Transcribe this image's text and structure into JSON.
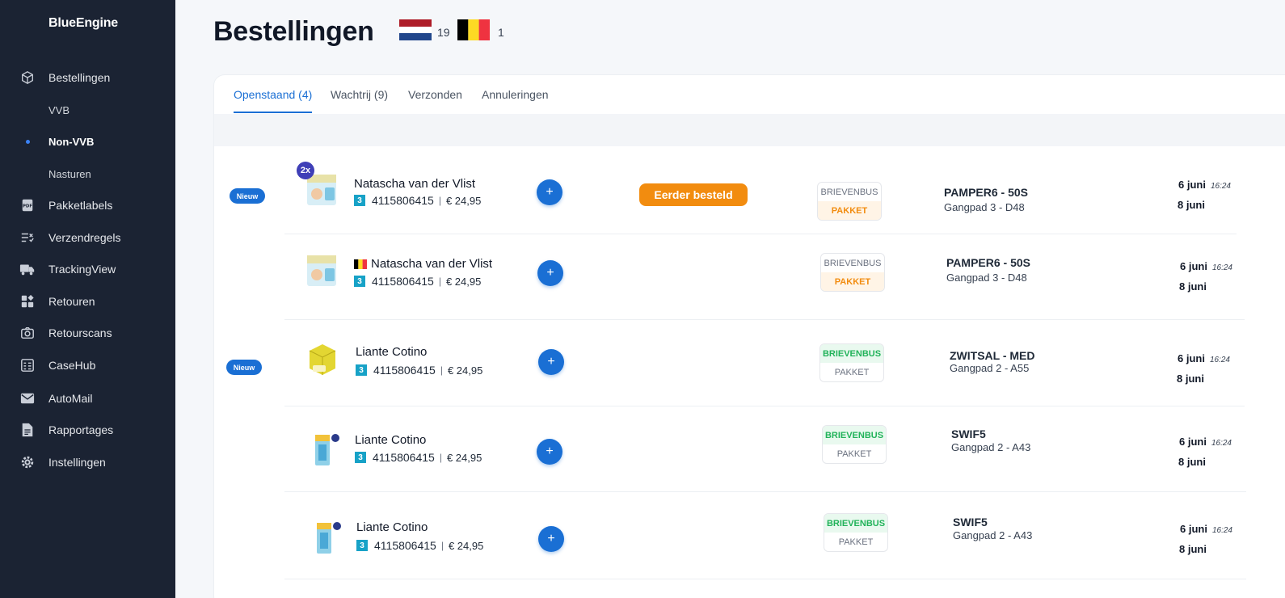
{
  "app": {
    "name": "BlueEngine"
  },
  "sidebar": {
    "items": [
      {
        "label": "Bestellingen",
        "icon": "box-icon"
      },
      {
        "label": "VVB",
        "sub": true
      },
      {
        "label": "Non-VVB",
        "sub": true,
        "active": true
      },
      {
        "label": "Nasturen",
        "sub": true
      },
      {
        "label": "Pakketlabels",
        "icon": "pdf-icon"
      },
      {
        "label": "Verzendregels",
        "icon": "rules-icon"
      },
      {
        "label": "TrackingView",
        "icon": "truck-icon"
      },
      {
        "label": "Retouren",
        "icon": "retour-icon"
      },
      {
        "label": "Retourscans",
        "icon": "camera-icon"
      },
      {
        "label": "CaseHub",
        "icon": "casehub-icon"
      },
      {
        "label": "AutoMail",
        "icon": "mail-icon"
      },
      {
        "label": "Rapportages",
        "icon": "report-icon"
      },
      {
        "label": "Instellingen",
        "icon": "gear-icon"
      }
    ]
  },
  "header": {
    "title": "Bestellingen",
    "countries": [
      {
        "flag": "netherlands-flag",
        "count": "19"
      },
      {
        "flag": "belgium-flag",
        "count": "1"
      }
    ]
  },
  "tabs": [
    {
      "label": "Openstaand (4)",
      "active": true
    },
    {
      "label": "Wachtrij (9)"
    },
    {
      "label": "Verzonden"
    },
    {
      "label": "Annuleringen"
    }
  ],
  "orders": [
    {
      "is_new": true,
      "new_label": "Nieuw",
      "qty": "2x",
      "customer": "Natascha van der Vlist",
      "country_flag": "",
      "order_no": "4115806415",
      "price": "€ 24,95",
      "tag": "Eerder besteld",
      "shipping": {
        "opt1": "BRIEVENBUS",
        "opt2": "PAKKET",
        "selected": "PAKKET"
      },
      "sku": "PAMPER6 - 50S",
      "location": "Gangpad 3 - D48",
      "date1": "6 juni",
      "time": "16:24",
      "date2": "8 juni",
      "product": "diaper-pack"
    },
    {
      "is_new": false,
      "qty": "",
      "customer": "Natascha van der Vlist",
      "country_flag": "belgium-flag",
      "order_no": "4115806415",
      "price": "€ 24,95",
      "shipping": {
        "opt1": "BRIEVENBUS",
        "opt2": "PAKKET",
        "selected": "PAKKET"
      },
      "sku": "PAMPER6 - 50S",
      "location": "Gangpad 3 - D48",
      "date1": "6 juni",
      "time": "16:24",
      "date2": "8 juni",
      "product": "diaper-pack"
    },
    {
      "is_new": true,
      "new_label": "Nieuw",
      "qty": "",
      "customer": "Liante Cotino",
      "country_flag": "",
      "order_no": "4115806415",
      "price": "€ 24,95",
      "shipping": {
        "opt1": "BRIEVENBUS",
        "opt2": "PAKKET",
        "selected": "BRIEVENBUS"
      },
      "sku": "ZWITSAL - MED",
      "location": "Gangpad 2 - A55",
      "date1": "6 juni",
      "time": "16:24",
      "date2": "8 juni",
      "product": "yellow-box"
    },
    {
      "is_new": false,
      "qty": "",
      "customer": "Liante Cotino",
      "country_flag": "",
      "order_no": "4115806415",
      "price": "€ 24,95",
      "shipping": {
        "opt1": "BRIEVENBUS",
        "opt2": "PAKKET",
        "selected": "BRIEVENBUS"
      },
      "sku": "SWIF5",
      "location": "Gangpad 2 - A43",
      "date1": "6 juni",
      "time": "16:24",
      "date2": "8 juni",
      "product": "swiffer-pack"
    },
    {
      "is_new": false,
      "qty": "",
      "customer": "Liante Cotino",
      "country_flag": "",
      "order_no": "4115806415",
      "price": "€ 24,95",
      "shipping": {
        "opt1": "BRIEVENBUS",
        "opt2": "PAKKET",
        "selected": "BRIEVENBUS"
      },
      "sku": "SWIF5",
      "location": "Gangpad 2 - A43",
      "date1": "6 juni",
      "time": "16:24",
      "date2": "8 juni",
      "product": "swiffer-pack"
    }
  ],
  "colors": {
    "accent": "#1a6fd4",
    "sidebar": "#1b2333",
    "orange": "#f28c0f",
    "green": "#22b35a"
  }
}
